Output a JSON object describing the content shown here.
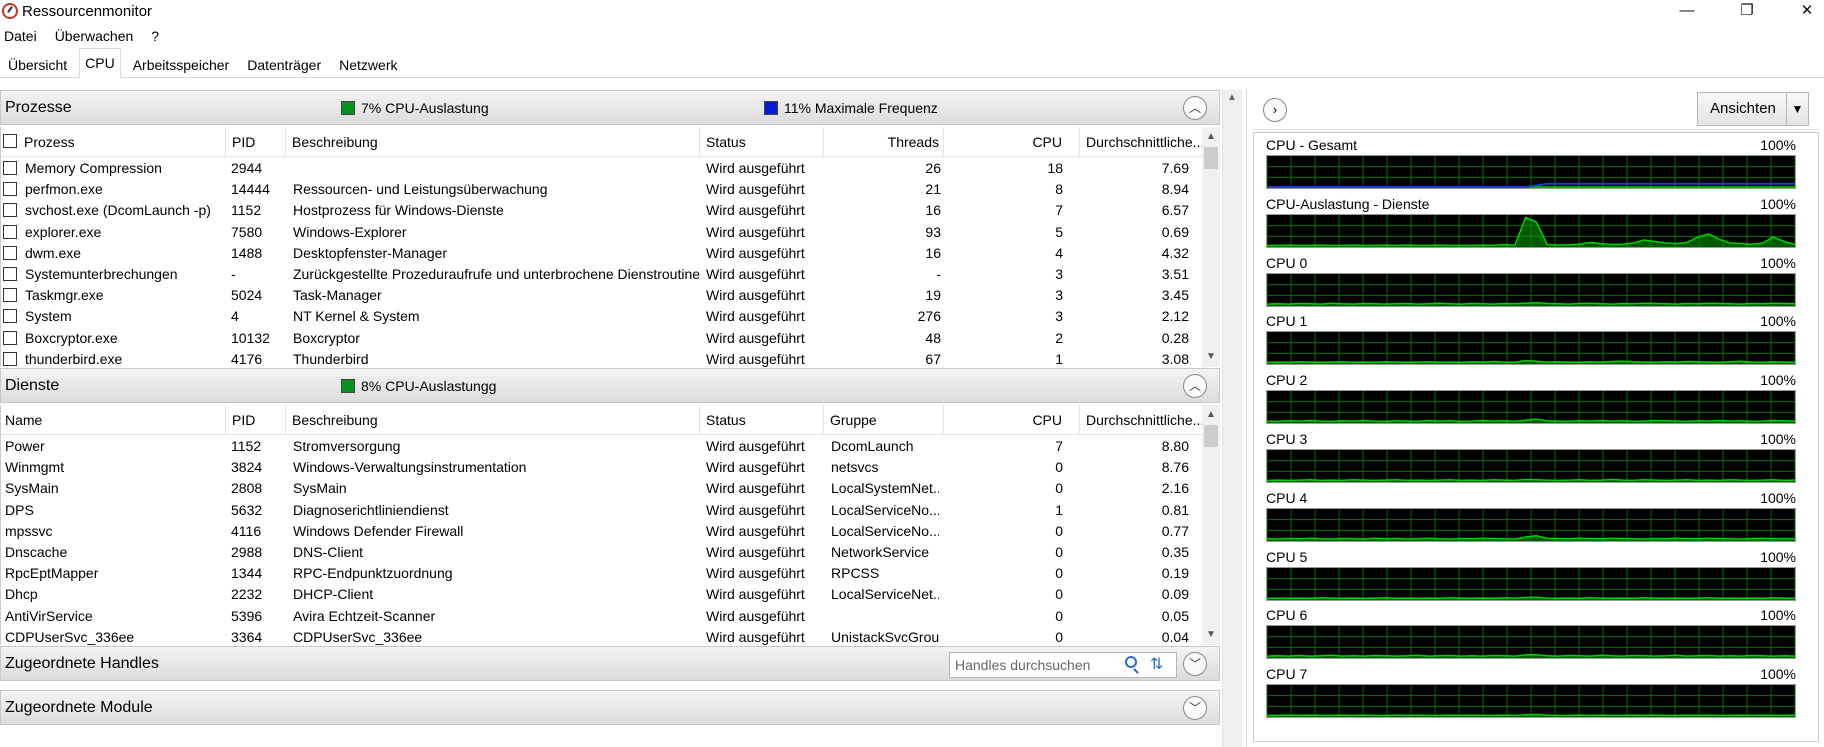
{
  "window": {
    "title": "Ressourcenmonitor",
    "minimize": "—",
    "maximize": "❐",
    "close": "✕"
  },
  "menu": [
    "Datei",
    "Überwachen",
    "?"
  ],
  "tabs": [
    "Übersicht",
    "CPU",
    "Arbeitsspeicher",
    "Datenträger",
    "Netzwerk"
  ],
  "active_tab": "CPU",
  "prozesse": {
    "title": "Prozesse",
    "cpu_badge": "7% CPU-Auslastung",
    "freq_badge": "11% Maximale Frequenz",
    "columns": [
      "Prozess",
      "PID",
      "Beschreibung",
      "Status",
      "Threads",
      "CPU",
      "Durchschnittliche..."
    ],
    "rows": [
      [
        "Memory Compression",
        "2944",
        "",
        "Wird ausgeführt",
        "26",
        "18",
        "7.69"
      ],
      [
        "perfmon.exe",
        "14444",
        "Ressourcen- und Leistungsüberwachung",
        "Wird ausgeführt",
        "21",
        "8",
        "8.94"
      ],
      [
        "svchost.exe (DcomLaunch -p)",
        "1152",
        "Hostprozess für Windows-Dienste",
        "Wird ausgeführt",
        "16",
        "7",
        "6.57"
      ],
      [
        "explorer.exe",
        "7580",
        "Windows-Explorer",
        "Wird ausgeführt",
        "93",
        "5",
        "0.69"
      ],
      [
        "dwm.exe",
        "1488",
        "Desktopfenster-Manager",
        "Wird ausgeführt",
        "16",
        "4",
        "4.32"
      ],
      [
        "Systemunterbrechungen",
        "-",
        "Zurückgestellte Prozeduraufrufe und unterbrochene Dienstroutinen",
        "Wird ausgeführt",
        "-",
        "3",
        "3.51"
      ],
      [
        "Taskmgr.exe",
        "5024",
        "Task-Manager",
        "Wird ausgeführt",
        "19",
        "3",
        "3.45"
      ],
      [
        "System",
        "4",
        "NT Kernel & System",
        "Wird ausgeführt",
        "276",
        "3",
        "2.12"
      ],
      [
        "Boxcryptor.exe",
        "10132",
        "Boxcryptor",
        "Wird ausgeführt",
        "48",
        "2",
        "0.28"
      ],
      [
        "thunderbird.exe",
        "4176",
        "Thunderbird",
        "Wird ausgeführt",
        "67",
        "1",
        "3.08"
      ]
    ]
  },
  "dienste": {
    "title": "Dienste",
    "cpu_badge": "8% CPU-Auslastungg",
    "columns": [
      "Name",
      "PID",
      "Beschreibung",
      "Status",
      "Gruppe",
      "CPU",
      "Durchschnittliche..."
    ],
    "rows": [
      [
        "Power",
        "1152",
        "Stromversorgung",
        "Wird ausgeführt",
        "DcomLaunch",
        "7",
        "8.80"
      ],
      [
        "Winmgmt",
        "3824",
        "Windows-Verwaltungsinstrumentation",
        "Wird ausgeführt",
        "netsvcs",
        "0",
        "8.76"
      ],
      [
        "SysMain",
        "2808",
        "SysMain",
        "Wird ausgeführt",
        "LocalSystemNet...",
        "0",
        "2.16"
      ],
      [
        "DPS",
        "5632",
        "Diagnoserichtliniendienst",
        "Wird ausgeführt",
        "LocalServiceNo...",
        "1",
        "0.81"
      ],
      [
        "mpssvc",
        "4116",
        "Windows Defender Firewall",
        "Wird ausgeführt",
        "LocalServiceNo...",
        "0",
        "0.77"
      ],
      [
        "Dnscache",
        "2988",
        "DNS-Client",
        "Wird ausgeführt",
        "NetworkService",
        "0",
        "0.35"
      ],
      [
        "RpcEptMapper",
        "1344",
        "RPC-Endpunktzuordnung",
        "Wird ausgeführt",
        "RPCSS",
        "0",
        "0.19"
      ],
      [
        "Dhcp",
        "2232",
        "DHCP-Client",
        "Wird ausgeführt",
        "LocalServiceNet...",
        "0",
        "0.09"
      ],
      [
        "AntiVirService",
        "5396",
        "Avira Echtzeit-Scanner",
        "Wird ausgeführt",
        "",
        "0",
        "0.05"
      ],
      [
        "CDPUserSvc_336ee",
        "3364",
        "CDPUserSvc_336ee",
        "Wird ausgeführt",
        "UnistackSvcGroup",
        "0",
        "0.04"
      ]
    ]
  },
  "handles": {
    "title": "Zugeordnete Handles",
    "search_placeholder": "Handles durchsuchen"
  },
  "module": {
    "title": "Zugeordnete Module"
  },
  "graph_panel": {
    "views_label": "Ansichten",
    "graphs": [
      {
        "label": "CPU - Gesamt",
        "max": "100%",
        "util": [
          0,
          0,
          0,
          0,
          0,
          0,
          0,
          0,
          0,
          0,
          0,
          0,
          0,
          0,
          0,
          0,
          0,
          0,
          0,
          0,
          0,
          0,
          0,
          0,
          0,
          0,
          0,
          0,
          0,
          0,
          0,
          0,
          0,
          0,
          0,
          0,
          0,
          0,
          0,
          0,
          0,
          0,
          0,
          0,
          0,
          0,
          0,
          0,
          0,
          0
        ],
        "freq": [
          0,
          0,
          0,
          0,
          0,
          0,
          0,
          0,
          0,
          0,
          0,
          0,
          0,
          0,
          0,
          0,
          0,
          0,
          0,
          0,
          0,
          0,
          0,
          0,
          0,
          5,
          11,
          11,
          11,
          11,
          11,
          11,
          11,
          11,
          11,
          11,
          11,
          11,
          11,
          11,
          11,
          11,
          11,
          11,
          11,
          11,
          11,
          11,
          11,
          11
        ]
      },
      {
        "label": "CPU-Auslastung - Dienste",
        "max": "100%",
        "util": [
          2,
          2,
          3,
          2,
          2,
          3,
          2,
          2,
          3,
          2,
          2,
          3,
          2,
          3,
          2,
          2,
          3,
          2,
          2,
          2,
          3,
          2,
          5,
          2,
          95,
          80,
          5,
          3,
          4,
          6,
          12,
          8,
          5,
          6,
          10,
          20,
          15,
          10,
          8,
          12,
          30,
          40,
          22,
          10,
          8,
          6,
          10,
          30,
          15,
          5
        ]
      },
      {
        "label": "CPU 0",
        "max": "100%",
        "util": [
          3,
          4,
          3,
          5,
          4,
          3,
          6,
          4,
          3,
          5,
          4,
          3,
          4,
          5,
          3,
          4,
          6,
          4,
          3,
          5,
          4,
          3,
          5,
          4,
          6,
          8,
          5,
          4,
          3,
          5,
          6,
          4,
          3,
          5,
          4,
          6,
          5,
          4,
          3,
          5,
          4,
          6,
          5,
          4,
          3,
          5,
          4,
          6,
          5,
          4
        ]
      },
      {
        "label": "CPU 1",
        "max": "100%",
        "util": [
          2,
          3,
          2,
          4,
          3,
          2,
          3,
          4,
          2,
          3,
          2,
          4,
          3,
          2,
          3,
          4,
          2,
          3,
          2,
          4,
          3,
          5,
          3,
          2,
          8,
          6,
          3,
          4,
          3,
          2,
          4,
          3,
          5,
          6,
          4,
          3,
          2,
          4,
          3,
          5,
          4,
          3,
          2,
          4,
          6,
          3,
          2,
          4,
          3,
          2
        ]
      },
      {
        "label": "CPU 2",
        "max": "100%",
        "util": [
          3,
          2,
          4,
          3,
          5,
          3,
          2,
          4,
          3,
          5,
          3,
          2,
          4,
          3,
          2,
          5,
          3,
          4,
          2,
          3,
          5,
          3,
          4,
          2,
          6,
          9,
          4,
          3,
          2,
          4,
          3,
          5,
          3,
          4,
          2,
          3,
          5,
          4,
          3,
          2,
          4,
          3,
          5,
          3,
          4,
          2,
          3,
          5,
          4,
          3
        ]
      },
      {
        "label": "CPU 3",
        "max": "100%",
        "util": [
          2,
          3,
          2,
          3,
          4,
          2,
          3,
          2,
          4,
          3,
          2,
          3,
          4,
          2,
          3,
          2,
          3,
          4,
          2,
          3,
          2,
          4,
          3,
          2,
          5,
          4,
          3,
          2,
          3,
          4,
          2,
          3,
          5,
          3,
          2,
          4,
          3,
          2,
          3,
          4,
          2,
          3,
          2,
          4,
          3,
          2,
          3,
          4,
          2,
          3
        ]
      },
      {
        "label": "CPU 4",
        "max": "100%",
        "util": [
          4,
          3,
          5,
          4,
          6,
          4,
          3,
          5,
          4,
          3,
          6,
          4,
          5,
          3,
          4,
          6,
          4,
          3,
          5,
          4,
          6,
          5,
          4,
          3,
          10,
          14,
          6,
          5,
          4,
          6,
          5,
          4,
          6,
          5,
          4,
          3,
          5,
          4,
          6,
          5,
          4,
          6,
          5,
          4,
          3,
          5,
          6,
          4,
          5,
          4
        ]
      },
      {
        "label": "CPU 5",
        "max": "100%",
        "util": [
          2,
          3,
          2,
          3,
          2,
          4,
          3,
          2,
          3,
          2,
          3,
          4,
          2,
          3,
          2,
          3,
          2,
          4,
          3,
          2,
          3,
          2,
          4,
          3,
          5,
          6,
          3,
          2,
          3,
          2,
          4,
          3,
          2,
          3,
          2,
          4,
          3,
          2,
          3,
          2,
          3,
          4,
          2,
          3,
          2,
          3,
          2,
          4,
          3,
          2
        ]
      },
      {
        "label": "CPU 6",
        "max": "100%",
        "util": [
          3,
          4,
          3,
          5,
          3,
          4,
          6,
          3,
          4,
          3,
          5,
          4,
          3,
          4,
          6,
          3,
          4,
          5,
          3,
          4,
          3,
          5,
          4,
          3,
          7,
          8,
          4,
          3,
          5,
          4,
          3,
          6,
          4,
          3,
          5,
          4,
          3,
          4,
          6,
          3,
          4,
          5,
          3,
          4,
          3,
          5,
          4,
          3,
          4,
          3
        ]
      },
      {
        "label": "CPU 7",
        "max": "100%",
        "util": [
          2,
          2,
          3,
          2,
          3,
          2,
          2,
          3,
          2,
          3,
          2,
          2,
          3,
          2,
          3,
          2,
          2,
          3,
          2,
          3,
          2,
          2,
          3,
          2,
          4,
          5,
          3,
          2,
          2,
          3,
          2,
          3,
          2,
          2,
          3,
          2,
          3,
          2,
          2,
          3,
          2,
          3,
          2,
          2,
          3,
          2,
          3,
          2,
          2,
          3
        ]
      }
    ]
  },
  "colors": {
    "util_line": "#00d200",
    "util_fill": "#00a000",
    "freq_line": "#1e3ccc",
    "grid": "#0a6e0a"
  }
}
